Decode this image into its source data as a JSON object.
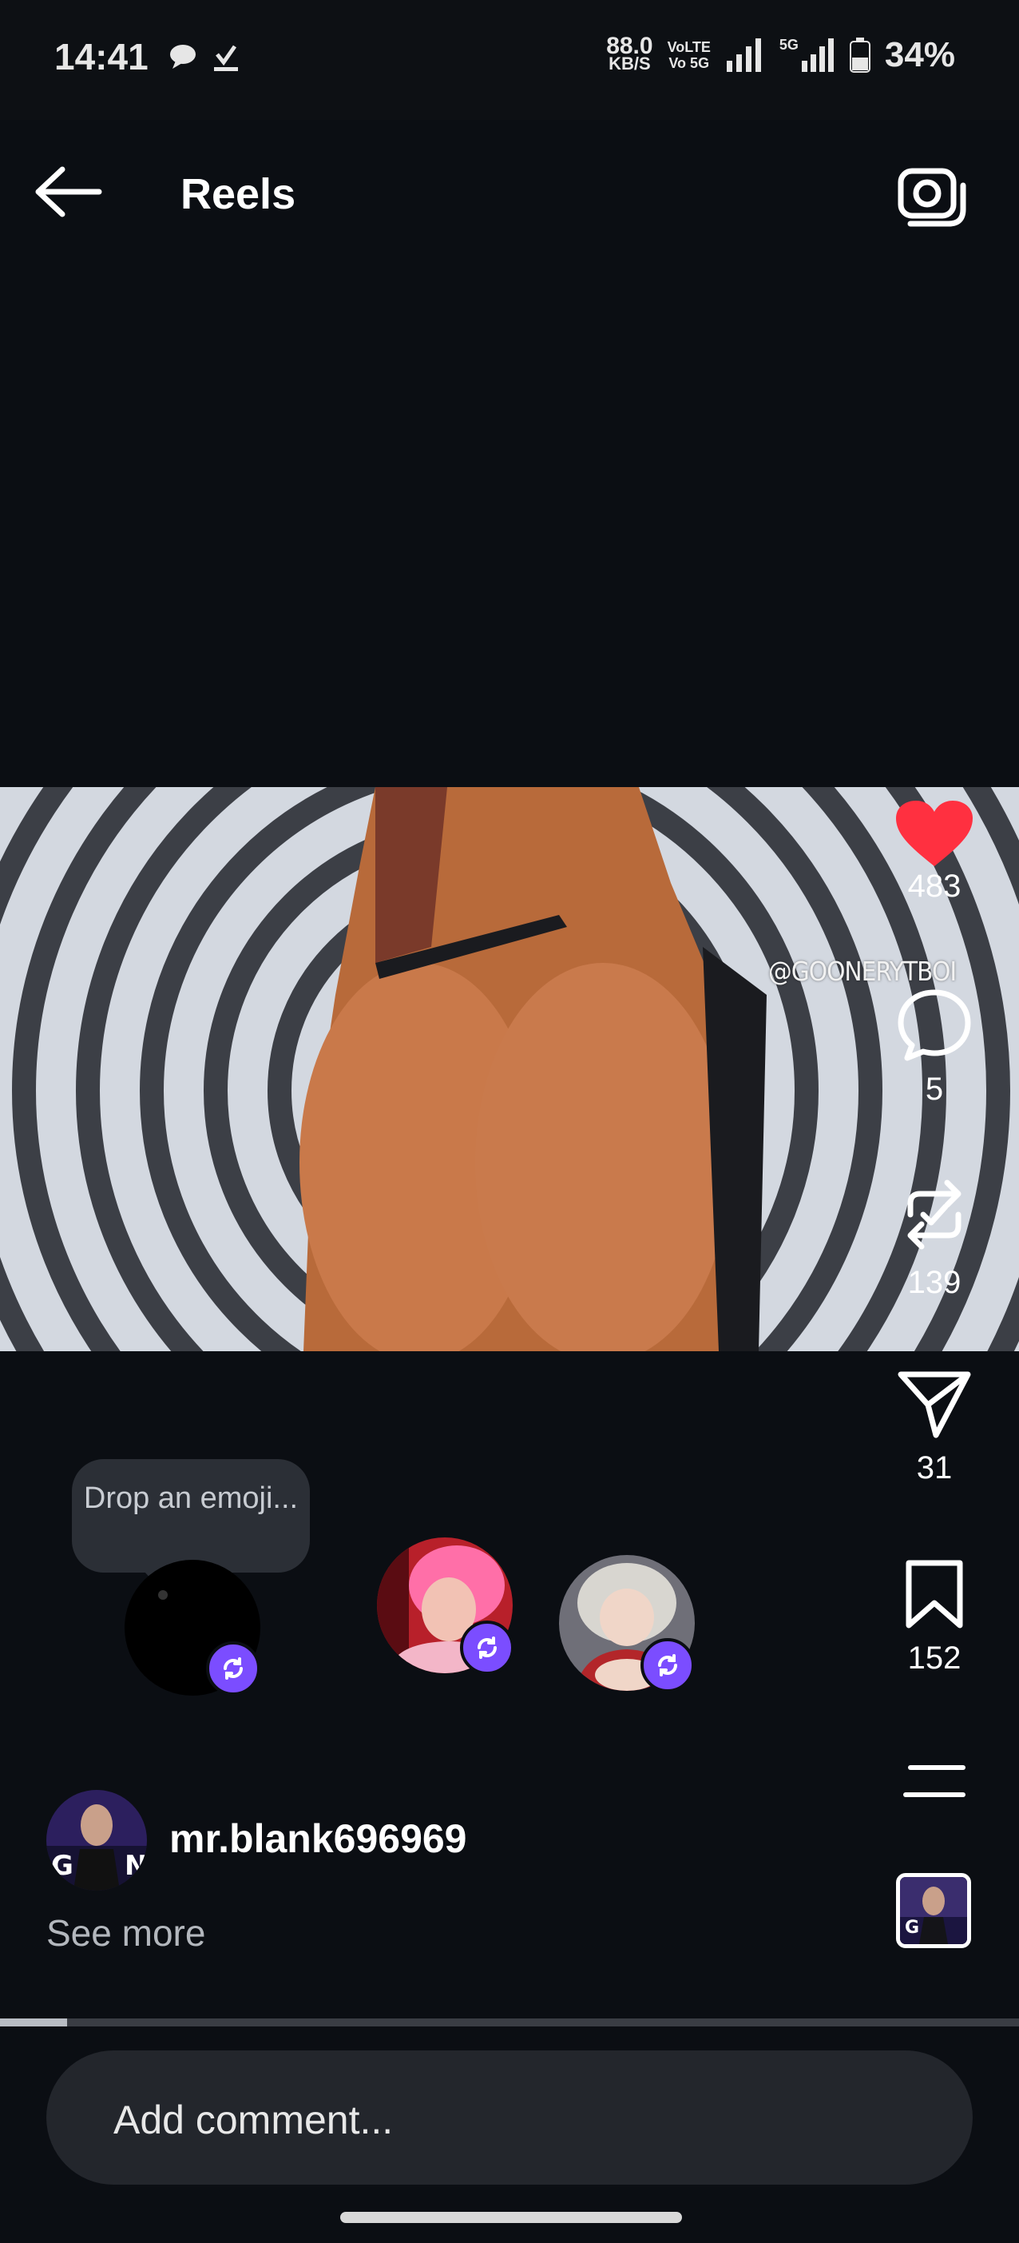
{
  "status_bar": {
    "time": "14:41",
    "net_speed_value": "88.0",
    "net_speed_unit": "KB/S",
    "volte_label": "VoLTE",
    "vo_label": "Vo 5G",
    "fiveg_label": "5G",
    "battery": "34%"
  },
  "header": {
    "title": "Reels"
  },
  "video": {
    "watermark": "@GOONERYTBOI"
  },
  "actions": {
    "likes": "483",
    "comments": "5",
    "reposts": "139",
    "shares": "31",
    "saves": "152"
  },
  "reposters": {
    "emoji_prompt": "Drop an emoji..."
  },
  "post": {
    "username": "mr.blank696969",
    "see_more": "See more",
    "progress": 0.066
  },
  "comment": {
    "placeholder": "Add comment..."
  },
  "colors": {
    "background": "#0b0e13",
    "like_red": "#ff3040",
    "repost_badge": "#7b4dff"
  }
}
